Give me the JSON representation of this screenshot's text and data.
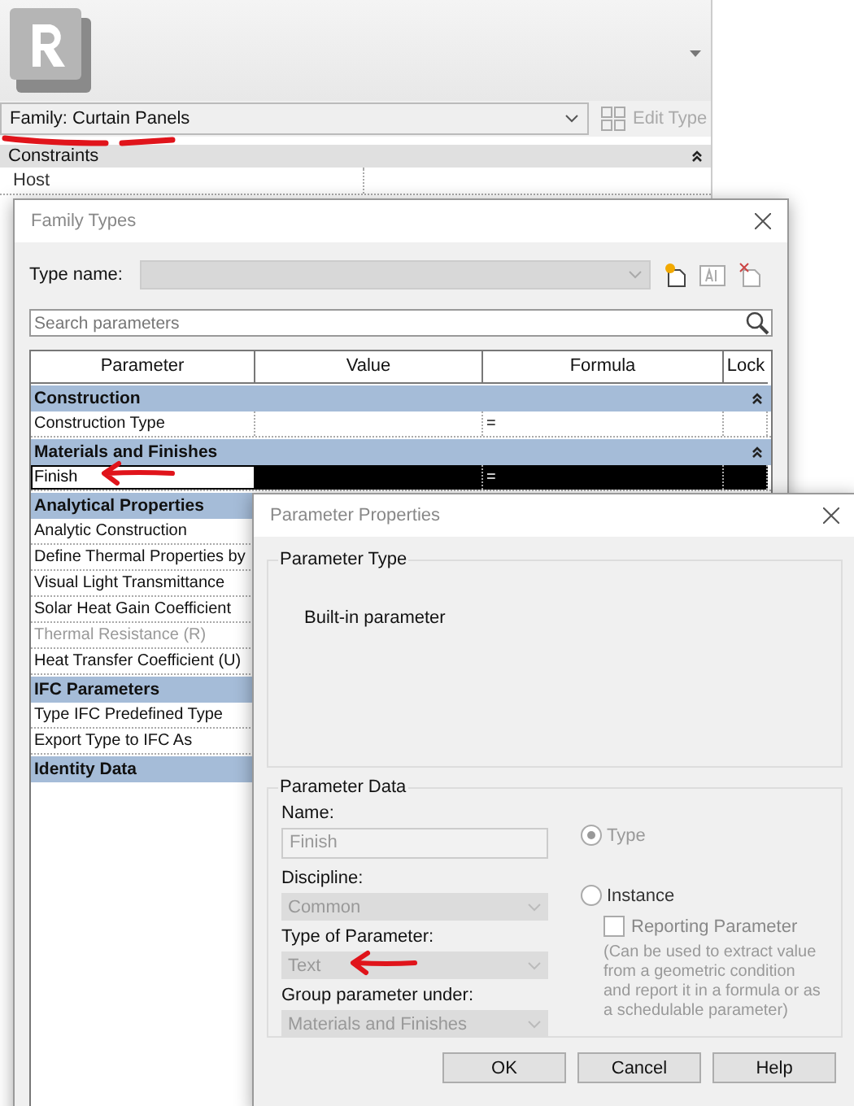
{
  "properties_panel": {
    "family_selector": "Family: Curtain Panels",
    "edit_type_button": {
      "label": "Edit Type",
      "disabled": true
    },
    "groups": [
      {
        "label": "Constraints",
        "expanded": true,
        "rows": [
          {
            "label": "Host"
          }
        ]
      }
    ]
  },
  "family_types_dialog": {
    "title": "Family Types",
    "type_name_label": "Type name:",
    "search": {
      "placeholder": "Search parameters"
    },
    "columns": [
      "Parameter",
      "Value",
      "Formula",
      "Lock"
    ],
    "rows": [
      {
        "kind": "group",
        "label": "Construction",
        "expanded": true
      },
      {
        "kind": "param",
        "label": "Construction Type",
        "formula": "=",
        "selected": false,
        "disabled": false
      },
      {
        "kind": "group",
        "label": "Materials and Finishes",
        "expanded": true
      },
      {
        "kind": "param",
        "label": "Finish",
        "formula": "=",
        "selected": true,
        "disabled": false
      },
      {
        "kind": "group",
        "label": "Analytical Properties"
      },
      {
        "kind": "param",
        "label": "Analytic Construction",
        "selected": false,
        "disabled": false
      },
      {
        "kind": "param",
        "label": "Define Thermal Properties by",
        "selected": false,
        "disabled": false
      },
      {
        "kind": "param",
        "label": "Visual Light Transmittance",
        "selected": false,
        "disabled": false
      },
      {
        "kind": "param",
        "label": "Solar Heat Gain Coefficient",
        "selected": false,
        "disabled": false
      },
      {
        "kind": "param",
        "label": "Thermal Resistance (R)",
        "selected": false,
        "disabled": true
      },
      {
        "kind": "param",
        "label": "Heat Transfer Coefficient (U)",
        "selected": false,
        "disabled": false
      },
      {
        "kind": "group",
        "label": "IFC Parameters"
      },
      {
        "kind": "param",
        "label": "Type IFC Predefined Type",
        "selected": false,
        "disabled": false
      },
      {
        "kind": "param",
        "label": "Export Type to IFC As",
        "selected": false,
        "disabled": false
      },
      {
        "kind": "group",
        "label": "Identity Data"
      }
    ]
  },
  "parameter_properties_dialog": {
    "title": "Parameter Properties",
    "parameter_type": {
      "legend": "Parameter Type",
      "text": "Built-in parameter"
    },
    "parameter_data": {
      "legend": "Parameter Data",
      "name": {
        "label": "Name:",
        "value": "Finish"
      },
      "discipline": {
        "label": "Discipline:",
        "value": "Common"
      },
      "type_of_parameter": {
        "label": "Type of Parameter:",
        "value": "Text"
      },
      "group_under": {
        "label": "Group parameter under:",
        "value": "Materials and Finishes"
      },
      "scope": [
        {
          "label": "Type",
          "selected": true,
          "disabled": true
        },
        {
          "label": "Instance",
          "selected": false,
          "disabled": false
        }
      ],
      "reporting": {
        "label": "Reporting Parameter",
        "checked": false,
        "disabled": true
      },
      "note": "(Can be used to extract value from a geometric condition and report it in a formula or as a schedulable parameter)"
    },
    "buttons": [
      "OK",
      "Cancel",
      "Help"
    ]
  }
}
